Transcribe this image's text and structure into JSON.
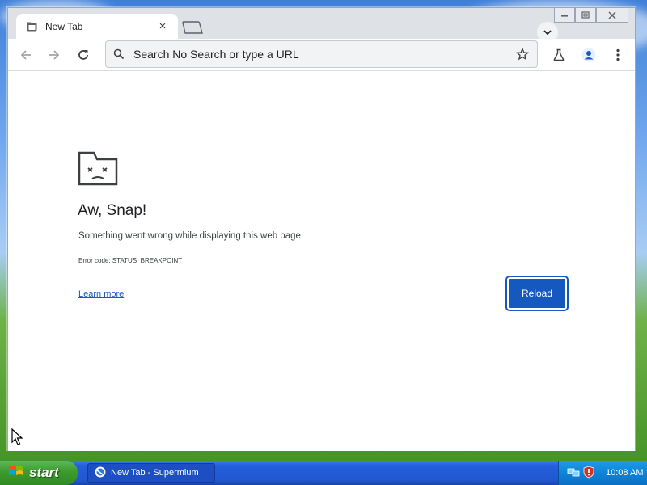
{
  "browser": {
    "tab": {
      "title": "New Tab"
    },
    "omnibox": {
      "placeholder": "Search No Search or type a URL"
    }
  },
  "error_page": {
    "heading": "Aw, Snap!",
    "message": "Something went wrong while displaying this web page.",
    "error_code": "Error code: STATUS_BREAKPOINT",
    "learn_more": "Learn more",
    "reload": "Reload"
  },
  "taskbar": {
    "start_label": "start",
    "task_item": "New Tab - Supermium",
    "clock": "10:08 AM"
  },
  "icons": {
    "tab": [
      "tab-favicon-icon",
      "close-icon",
      "new-tab-icon",
      "chevron-down-icon"
    ],
    "window": [
      "minimize-icon",
      "maximize-icon",
      "close-window-icon"
    ],
    "toolbar": [
      "back-arrow-icon",
      "forward-arrow-icon",
      "reload-icon",
      "search-icon",
      "star-icon",
      "flask-icon",
      "profile-icon",
      "kebab-menu-icon"
    ],
    "page": [
      "sad-folder-icon"
    ],
    "taskbar": [
      "windows-logo-icon",
      "supermium-icon",
      "network-icon",
      "shield-alert-icon"
    ]
  },
  "colors": {
    "accent": "#1558c0",
    "link": "#1a57c7",
    "taskbar": "#245edb",
    "start": "#3d9c2d"
  }
}
